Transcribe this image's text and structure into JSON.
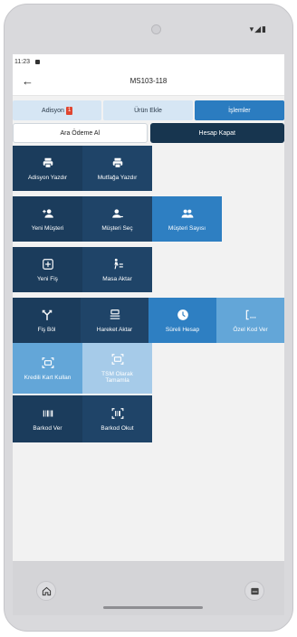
{
  "device": {
    "status_icons": "▾◢▮"
  },
  "statusbar": {
    "time": "11:23"
  },
  "appbar": {
    "title": "MS103-118",
    "back_icon": "arrow-left"
  },
  "tabs": [
    {
      "label": "Adisyon",
      "badge": "1"
    },
    {
      "label": "Ürün Ekle"
    },
    {
      "label": "İşlemler",
      "active": true
    }
  ],
  "payment": {
    "partial": "Ara Ödeme Al",
    "close": "Hesap Kapat"
  },
  "actions": {
    "adisyon_yazdir": "Adisyon Yazdır",
    "mutfaga_yazdir": "Mutfağa Yazdır",
    "yeni_musteri": "Yeni Müşteri",
    "musteri_sec": "Müşteri Seç",
    "musteri_sayisi": "Müşteri Sayısı",
    "yeni_fis": "Yeni Fiş",
    "masa_aktar": "Masa Aktar",
    "fis_bol": "Fiş Böl",
    "hareket_aktar": "Hareket Aktar",
    "sureli_hesap": "Süreli Hesap",
    "ozel_kod_ver": "Özel Kod Ver",
    "kredi_karti": "Kredili Kart Kullan",
    "tsm_olarak": "TSM Olarak Tamamla",
    "barkod_ver": "Barkod Ver",
    "barkod_okut": "Barkod Okut"
  },
  "colors": {
    "dark": "#1b3c5c",
    "primary": "#2e7fc2",
    "light": "#63a6d8",
    "pale": "#a6cbe9",
    "badge": "#e0452f"
  }
}
